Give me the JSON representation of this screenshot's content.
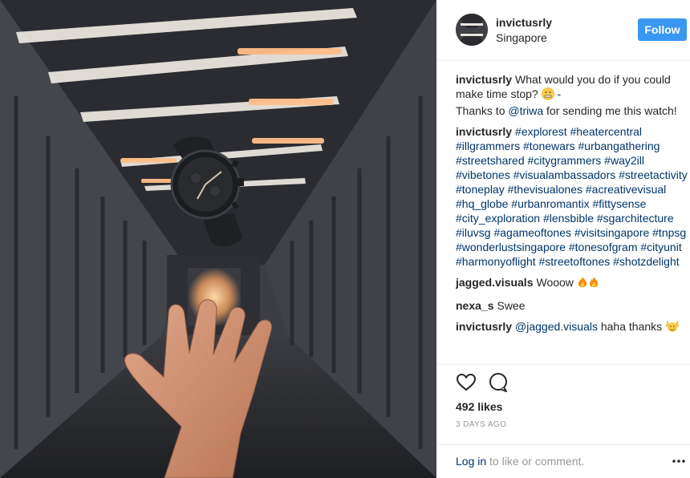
{
  "post": {
    "username": "invictusrly",
    "location": "Singapore",
    "follow_label": "Follow",
    "photo_alt": "Wristwatch floating above an open hand on a covered footbridge"
  },
  "comments": [
    {
      "author": "invictusrly",
      "lines": [
        {
          "prefix": "What would you do if you could make time stop? ",
          "emoji": "grimacing",
          "suffix": " -"
        },
        {
          "prefix": "Thanks to ",
          "mention": "@triwa",
          "suffix": " for sending me this watch!"
        }
      ]
    },
    {
      "author": "invictusrly",
      "hashtags": "#explorest #heatercentral #illgrammers #tonewars #urbangathering #streetshared #citygrammers #way2ill #vibetones #visualambassadors #streetactivity #toneplay #thevisualones #acreativevisual #hq_globe #urbanromantix #fittysense #city_exploration #lensbible #sgarchitecture #iluvsg #agameoftones #visitsingapore #tnpsg #wonderlustsingapore #tonesofgram #cityunit #harmonyoflight #streetoftones #shotzdelight"
    },
    {
      "author": "jagged.visuals",
      "text": "Wooow",
      "emoji": "fire-fire"
    },
    {
      "author": "nexa_s",
      "text": "Swee"
    },
    {
      "author": "invictusrly",
      "mention": "@jagged.visuals",
      "text": " haha thanks",
      "emoji": "raised-hands"
    }
  ],
  "actions": {
    "like_icon": "heart-icon",
    "comment_icon": "comment-bubble-icon",
    "likes_text": "492 likes",
    "timestamp": "3 DAYS AGO"
  },
  "footer": {
    "login_label": "Log in",
    "login_suffix": " to like or comment.",
    "more_icon": "more-options-icon"
  },
  "colors": {
    "follow_button": "#3897f0",
    "link": "#003569",
    "muted": "#999999",
    "divider": "#efefef"
  }
}
